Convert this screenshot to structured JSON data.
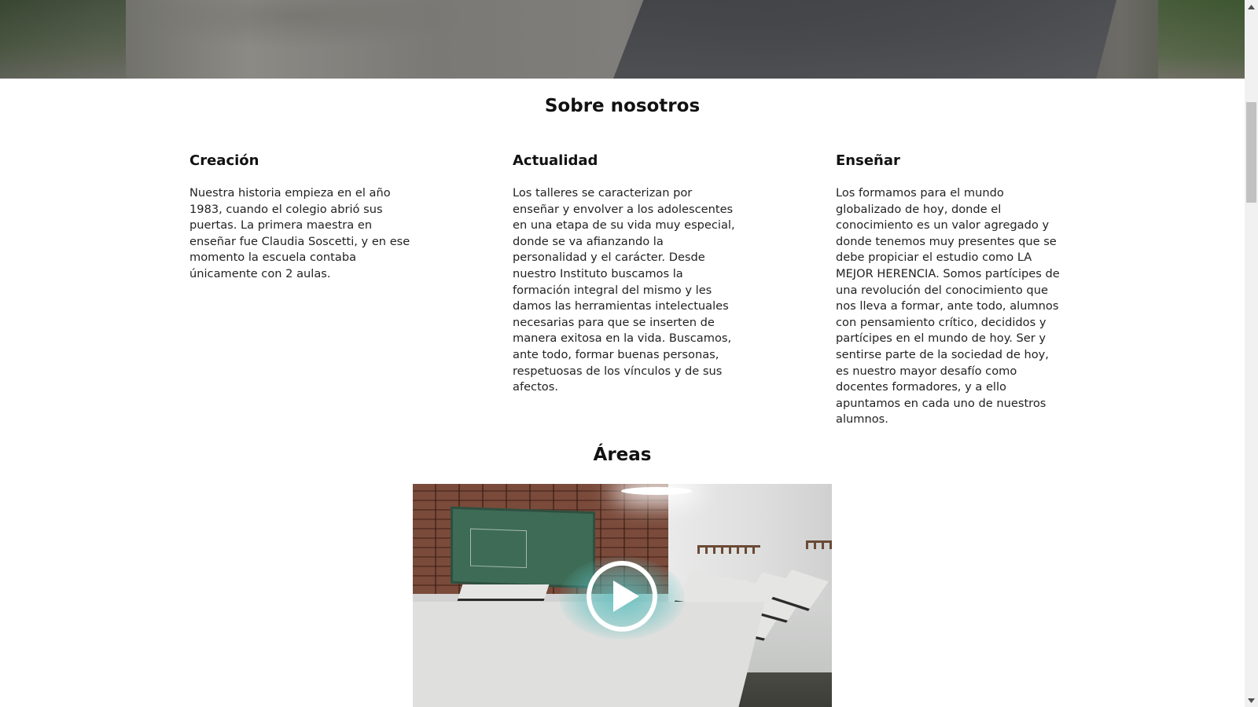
{
  "about": {
    "title": "Sobre nosotros",
    "columns": [
      {
        "heading": "Creación",
        "text": "Nuestra historia empieza en el año 1983, cuando el colegio abrió sus puertas. La primera maestra en enseñar fue Claudia Soscetti, y en ese momento la escuela contaba únicamente con 2 aulas."
      },
      {
        "heading": "Actualidad",
        "text": "Los talleres se caracterizan por enseñar y envolver a los adolescentes en una etapa de su vida muy especial, donde se va afianzando la personalidad y el carácter. Desde nuestro Instituto buscamos la formación integral del mismo y les damos las herramientas intelectuales necesarias para que se inserten de manera exitosa en la vida. Buscamos, ante todo, formar buenas personas, respetuosas de los vínculos y de sus afectos."
      },
      {
        "heading": "Enseñar",
        "text": "Los formamos para el mundo globalizado de hoy, donde el conocimiento es un valor agregado y donde tenemos muy presentes que se debe propiciar el estudio como LA MEJOR HERENCIA. Somos partícipes de una revolución del conocimiento que nos lleva a formar, ante todo, alumnos con pensamiento crítico, decididos y partícipes en el mundo de hoy. Ser y sentirse parte de la sociedad de hoy, es nuestro mayor desafío como docentes formadores, y a ello apuntamos en cada uno de nuestros alumnos."
      }
    ]
  },
  "areas": {
    "title": "Áreas",
    "video": {
      "play_icon": "play-icon"
    }
  },
  "scrollbar": {
    "up_icon": "scroll-up-arrow-icon",
    "down_icon": "scroll-down-arrow-icon"
  }
}
